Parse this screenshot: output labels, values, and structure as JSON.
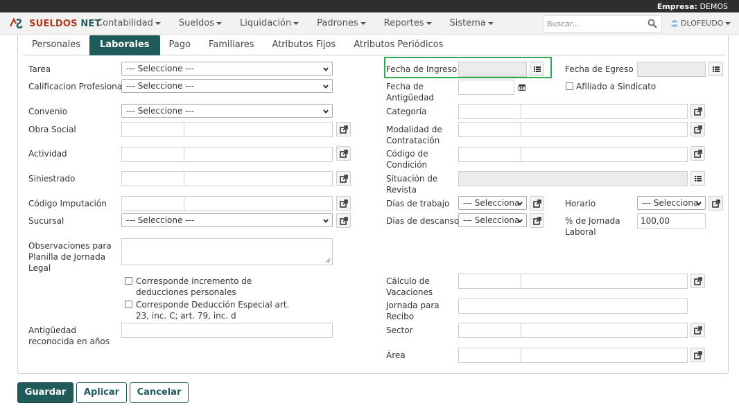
{
  "header": {
    "empresa_label": "Empresa:",
    "empresa_value": "DEMOS"
  },
  "brand": {
    "name_a": "SUELDOS",
    "name_b": " NET"
  },
  "menu": [
    {
      "label": "Contabilidad"
    },
    {
      "label": "Sueldos"
    },
    {
      "label": "Liquidación"
    },
    {
      "label": "Padrones"
    },
    {
      "label": "Reportes"
    },
    {
      "label": "Sistema"
    }
  ],
  "search": {
    "placeholder": "Buscar..."
  },
  "user": {
    "name": "DLOFEUDO"
  },
  "tabs": [
    {
      "label": "Personales"
    },
    {
      "label": "Laborales"
    },
    {
      "label": "Pago"
    },
    {
      "label": "Familiares"
    },
    {
      "label": "Atributos Fijos"
    },
    {
      "label": "Atributos Periódicos"
    }
  ],
  "select_placeholder": "--- Seleccione ---",
  "select_placeholder_short": "--- Selecciona",
  "left": {
    "tarea": "Tarea",
    "calificacion": "Calificacion Profesional",
    "convenio": "Convenio",
    "obra_social": "Obra Social",
    "actividad": "Actividad",
    "siniestrado": "Siniestrado",
    "codigo_imputacion": "Código Imputación",
    "sucursal": "Sucursal",
    "observaciones": "Observaciones para Planilla de Jornada Legal",
    "chk_incremento": "Corresponde incremento de deducciones personales",
    "chk_deduccion": "Corresponde Deducción Especial art. 23, inc. C; art. 79, inc. d",
    "antiguedad_reconocida": "Antigüedad reconocida en años"
  },
  "mid": {
    "fecha_ingreso": "Fecha de Ingreso",
    "fecha_antiguedad": "Fecha de Antigüedad",
    "categoria": "Categoría",
    "modalidad": "Modalidad de Contratación",
    "codigo_condicion": "Código de Condición",
    "situacion_revista": "Situación de Revista",
    "dias_trabajo": "Días de trabajo",
    "dias_descanso": "Días de descanso",
    "calculo_vacaciones": "Cálculo de Vacaciones",
    "jornada_recibo": "Jornada para Recibo",
    "sector": "Sector",
    "area": "Área"
  },
  "right": {
    "fecha_egreso": "Fecha de Egreso",
    "afiliado_sindicato": "Afiliado a Sindicato",
    "horario": "Horario",
    "pct_jornada": "% de Jornada Laboral",
    "pct_jornada_value": "100,00"
  },
  "footer": {
    "guardar": "Guardar",
    "aplicar": "Aplicar",
    "cancelar": "Cancelar"
  },
  "colors": {
    "brand": "#1e5b5a",
    "accent": "#b33a1f",
    "highlight": "#2fa84f"
  }
}
